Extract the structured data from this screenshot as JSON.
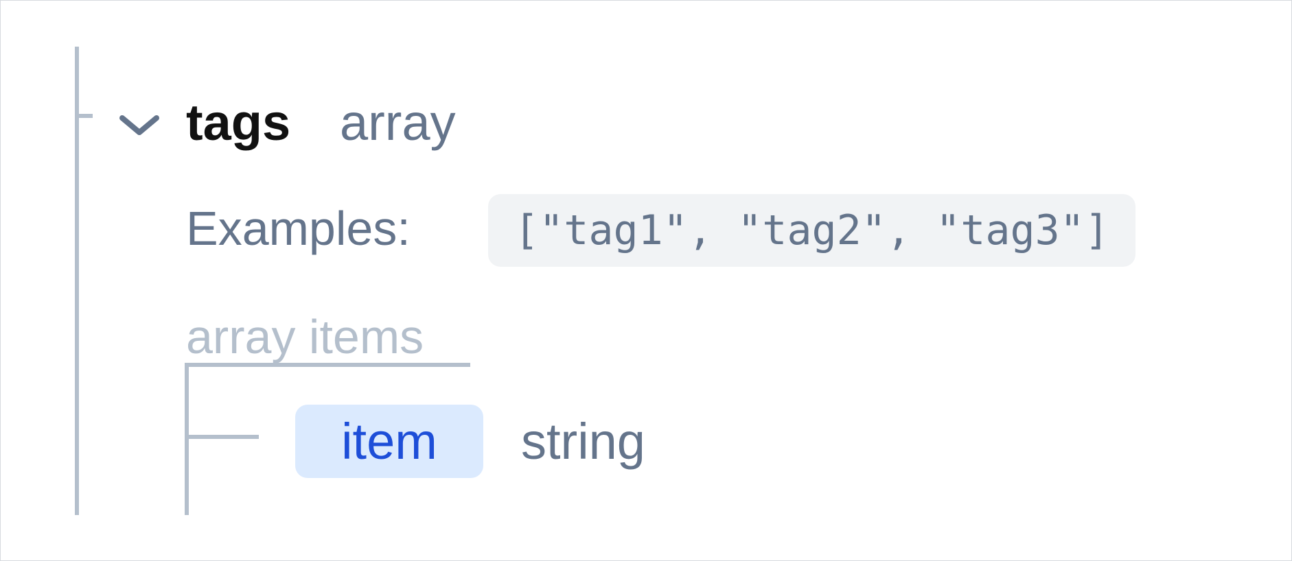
{
  "property": {
    "name": "tags",
    "type": "array",
    "expanded": true
  },
  "examples": {
    "label": "Examples:",
    "value": "[\"tag1\", \"tag2\", \"tag3\"]"
  },
  "array_items": {
    "label": "array items",
    "item": {
      "name": "item",
      "type": "string"
    }
  },
  "icons": {
    "toggle": "chevron-down-icon"
  },
  "colors": {
    "name_text": "#111111",
    "muted_text": "#64748b",
    "tree_line": "#b4bfcc",
    "example_bg": "#f1f3f5",
    "item_badge_bg": "#dbeafe",
    "item_badge_text": "#1d4ed8"
  }
}
